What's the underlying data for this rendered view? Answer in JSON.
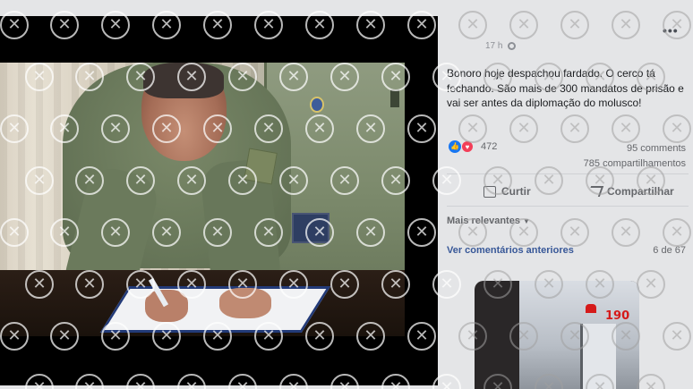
{
  "post": {
    "timestamp": "17 h",
    "text": "Bonoro hoje despachou fardado. O cerco tá fechando. São mais de 300 mandatos de prisão e vai ser antes da diplomação do molusco!",
    "reactions_count": "472",
    "comments_count": "95 comments",
    "shares_count": "785 compartilhamentos"
  },
  "actions": {
    "like_label": "Curtir",
    "share_label": "Compartilhar"
  },
  "comments": {
    "sort_label": "Mais relevantes",
    "prev_label": "Ver comentários anteriores",
    "paging": "6 de 67"
  },
  "comment_image": {
    "stamp_text": "190"
  },
  "icons": {
    "more": "more-options-icon",
    "privacy": "globe-icon",
    "like": "like-reaction-icon",
    "love": "love-reaction-icon",
    "watermark": "x-circle-watermark-icon"
  },
  "colors": {
    "panel_bg": "#e4e5e7",
    "link": "#385898",
    "like": "#1877f2",
    "love": "#f33e58"
  }
}
